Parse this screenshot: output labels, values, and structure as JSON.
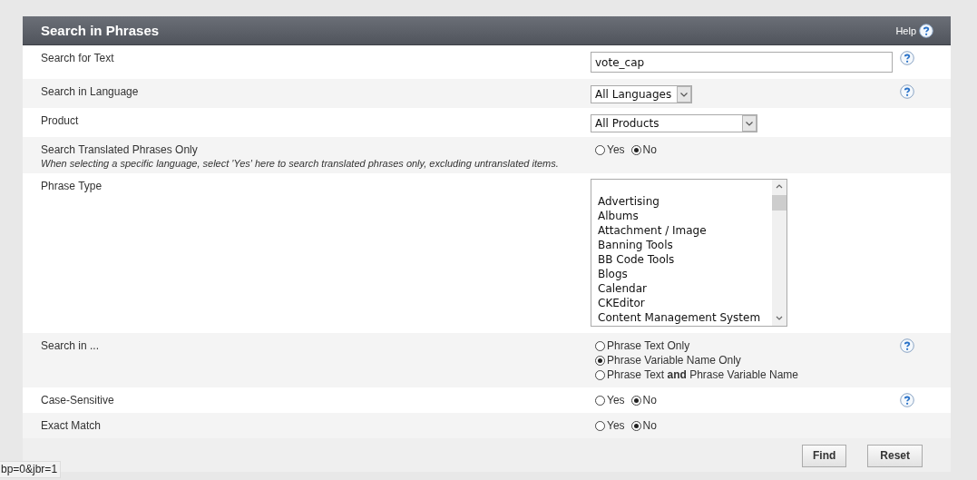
{
  "panel": {
    "title": "Search in Phrases",
    "help_link": "Help"
  },
  "rows": [
    {
      "kind": "text",
      "label": "Search for Text",
      "value": "vote_cap",
      "help": true
    },
    {
      "kind": "select",
      "label": "Search in Language",
      "value": "All Languages",
      "help": true
    },
    {
      "kind": "select",
      "label": "Product",
      "value": "All Products",
      "help": false
    },
    {
      "kind": "radio",
      "label": "Search Translated Phrases Only",
      "description": "When selecting a specific language, select 'Yes' here to search translated phrases only, excluding untranslated items.",
      "options": [
        {
          "label": "Yes",
          "selected": false
        },
        {
          "label": "No",
          "selected": true
        }
      ],
      "help": false
    },
    {
      "kind": "listbox",
      "label": "Phrase Type",
      "items": [
        "Advertising",
        "Albums",
        "Attachment / Image",
        "Banning Tools",
        "BB Code Tools",
        "Blogs",
        "Calendar",
        "CKEditor",
        "Content Management System"
      ],
      "help": false
    },
    {
      "kind": "radio-list",
      "label": "Search in ...",
      "options": [
        {
          "label": "Phrase Text Only",
          "selected": false
        },
        {
          "label": "Phrase Variable Name Only",
          "selected": true
        },
        {
          "label": "Phrase Text **and** Phrase Variable Name",
          "selected": false
        }
      ],
      "help": true
    },
    {
      "kind": "radio",
      "label": "Case-Sensitive",
      "options": [
        {
          "label": "Yes",
          "selected": false
        },
        {
          "label": "No",
          "selected": true
        }
      ],
      "help": true
    },
    {
      "kind": "radio",
      "label": "Exact Match",
      "options": [
        {
          "label": "Yes",
          "selected": false
        },
        {
          "label": "No",
          "selected": true
        }
      ],
      "help": false
    }
  ],
  "buttons": [
    "Find",
    "Reset"
  ],
  "status_url": "bp=0&jbr=1"
}
